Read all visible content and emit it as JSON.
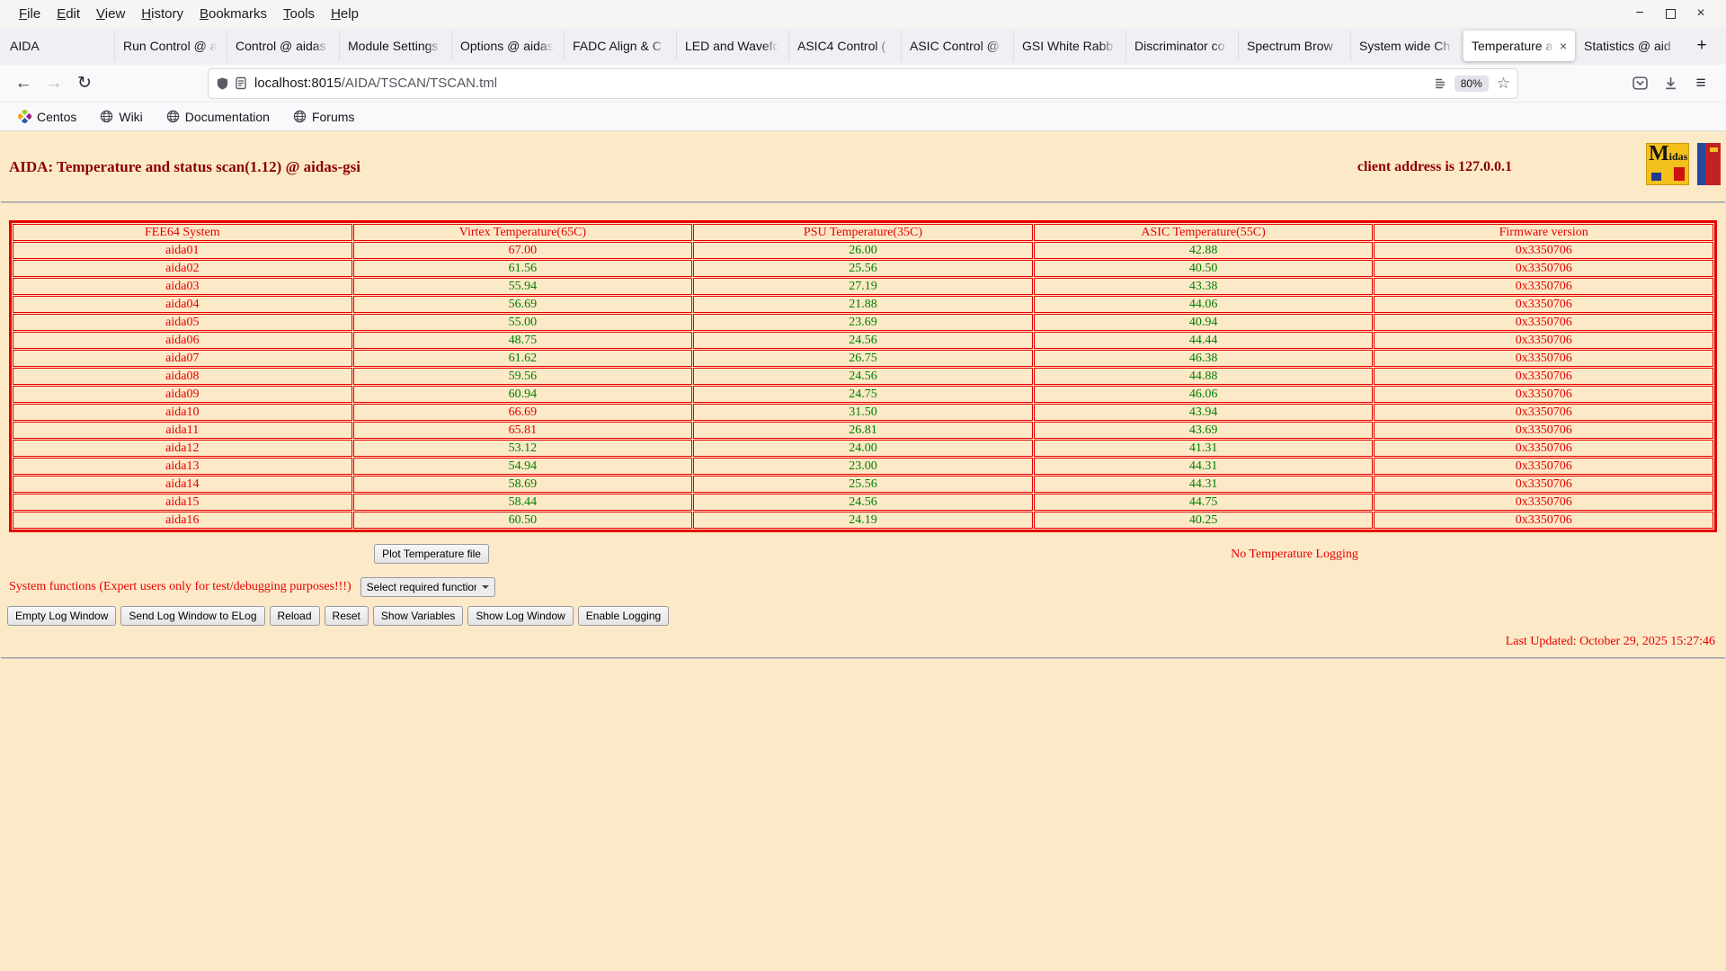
{
  "icons": {
    "minimize": "−",
    "close": "×",
    "back": "←",
    "forward": "→",
    "reload": "↻",
    "star": "☆",
    "menu": "≡",
    "close_tab": "×"
  },
  "colors": {
    "page_background": "#fce9c8",
    "heading_red": "#8b0000",
    "alert_red": "#e60000",
    "ok_green": "#008000"
  },
  "menubar": {
    "items": [
      "File",
      "Edit",
      "View",
      "History",
      "Bookmarks",
      "Tools",
      "Help"
    ]
  },
  "tabbar": {
    "tabs": [
      {
        "label": "AIDA",
        "active": false
      },
      {
        "label": "Run Control @ a",
        "active": false
      },
      {
        "label": "Control @ aidas",
        "active": false
      },
      {
        "label": "Module Settings",
        "active": false
      },
      {
        "label": "Options @ aidas",
        "active": false
      },
      {
        "label": "FADC Align & C",
        "active": false
      },
      {
        "label": "LED and Wavefo",
        "active": false
      },
      {
        "label": "ASIC4 Control (",
        "active": false
      },
      {
        "label": "ASIC Control @",
        "active": false
      },
      {
        "label": "GSI White Rabb",
        "active": false
      },
      {
        "label": "Discriminator co",
        "active": false
      },
      {
        "label": "Spectrum Brow",
        "active": false
      },
      {
        "label": "System wide Ch",
        "active": false
      },
      {
        "label": "Temperature a",
        "active": true
      },
      {
        "label": "Statistics @ aid",
        "active": false
      }
    ],
    "new_tab": "+"
  },
  "navbar": {
    "url_host": "localhost:8015",
    "url_path": "/AIDA/TSCAN/TSCAN.tml",
    "zoom_badge": "80%"
  },
  "bookmarks_bar": {
    "items": [
      "Centos",
      "Wiki",
      "Documentation",
      "Forums"
    ]
  },
  "page": {
    "heading": "AIDA: Temperature and status scan(1.12) @ aidas-gsi",
    "client_address": "client address is 127.0.0.1",
    "logos": {
      "midas": "Midas"
    },
    "table": {
      "headers": [
        "FEE64 System",
        "Virtex Temperature(65C)",
        "PSU Temperature(35C)",
        "ASIC Temperature(55C)",
        "Firmware version"
      ],
      "rows": [
        {
          "name": "aida01",
          "virtex": "67.00",
          "virtex_alarm": true,
          "psu": "26.00",
          "asic": "42.88",
          "firmware": "0x3350706"
        },
        {
          "name": "aida02",
          "virtex": "61.56",
          "virtex_alarm": false,
          "psu": "25.56",
          "asic": "40.50",
          "firmware": "0x3350706"
        },
        {
          "name": "aida03",
          "virtex": "55.94",
          "virtex_alarm": false,
          "psu": "27.19",
          "asic": "43.38",
          "firmware": "0x3350706"
        },
        {
          "name": "aida04",
          "virtex": "56.69",
          "virtex_alarm": false,
          "psu": "21.88",
          "asic": "44.06",
          "firmware": "0x3350706"
        },
        {
          "name": "aida05",
          "virtex": "55.00",
          "virtex_alarm": false,
          "psu": "23.69",
          "asic": "40.94",
          "firmware": "0x3350706"
        },
        {
          "name": "aida06",
          "virtex": "48.75",
          "virtex_alarm": false,
          "psu": "24.56",
          "asic": "44.44",
          "firmware": "0x3350706"
        },
        {
          "name": "aida07",
          "virtex": "61.62",
          "virtex_alarm": false,
          "psu": "26.75",
          "asic": "46.38",
          "firmware": "0x3350706"
        },
        {
          "name": "aida08",
          "virtex": "59.56",
          "virtex_alarm": false,
          "psu": "24.56",
          "asic": "44.88",
          "firmware": "0x3350706"
        },
        {
          "name": "aida09",
          "virtex": "60.94",
          "virtex_alarm": false,
          "psu": "24.75",
          "asic": "46.06",
          "firmware": "0x3350706"
        },
        {
          "name": "aida10",
          "virtex": "66.69",
          "virtex_alarm": true,
          "psu": "31.50",
          "asic": "43.94",
          "firmware": "0x3350706"
        },
        {
          "name": "aida11",
          "virtex": "65.81",
          "virtex_alarm": true,
          "psu": "26.81",
          "asic": "43.69",
          "firmware": "0x3350706"
        },
        {
          "name": "aida12",
          "virtex": "53.12",
          "virtex_alarm": false,
          "psu": "24.00",
          "asic": "41.31",
          "firmware": "0x3350706"
        },
        {
          "name": "aida13",
          "virtex": "54.94",
          "virtex_alarm": false,
          "psu": "23.00",
          "asic": "44.31",
          "firmware": "0x3350706"
        },
        {
          "name": "aida14",
          "virtex": "58.69",
          "virtex_alarm": false,
          "psu": "25.56",
          "asic": "44.31",
          "firmware": "0x3350706"
        },
        {
          "name": "aida15",
          "virtex": "58.44",
          "virtex_alarm": false,
          "psu": "24.56",
          "asic": "44.75",
          "firmware": "0x3350706"
        },
        {
          "name": "aida16",
          "virtex": "60.50",
          "virtex_alarm": false,
          "psu": "24.19",
          "asic": "40.25",
          "firmware": "0x3350706"
        }
      ]
    },
    "plot_button": "Plot Temperature file",
    "logging_status": "No Temperature Logging",
    "system_functions_label": "System functions (Expert users only for test/debugging purposes!!!)",
    "select_value": "Select required function",
    "action_buttons": [
      "Empty Log Window",
      "Send Log Window to ELog",
      "Reload",
      "Reset",
      "Show Variables",
      "Show Log Window",
      "Enable Logging"
    ],
    "last_updated": "Last Updated: October 29, 2025 15:27:46"
  }
}
